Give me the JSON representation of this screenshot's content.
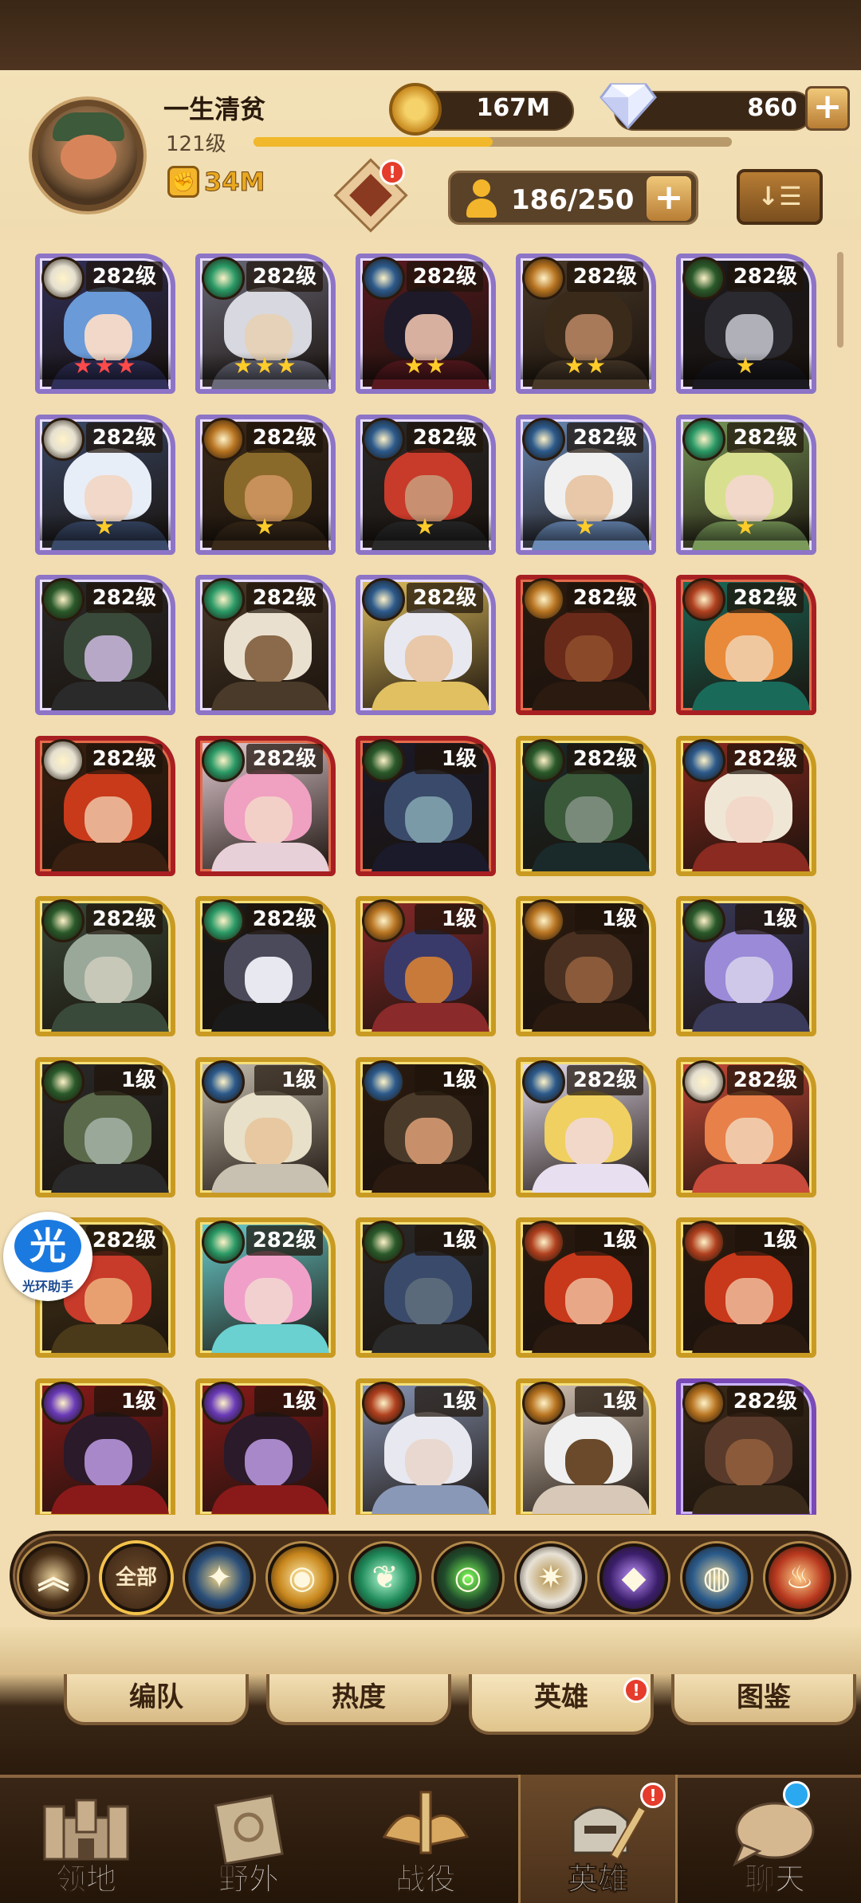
{
  "header": {
    "player_name": "一生清贫",
    "player_level": "121级",
    "xp_progress": 0.5,
    "power": "34M",
    "gold": "167M",
    "gems": "860",
    "plus": "+",
    "craft_badge": "!",
    "hero_count": "186/250",
    "sort_icon": "↓☰"
  },
  "heroes": [
    {
      "level": "282级",
      "faction": "celestial",
      "frame": "purple",
      "stars": "★★★",
      "star_color": "red"
    },
    {
      "level": "282级",
      "faction": "wilder",
      "frame": "purple",
      "stars": "★★★",
      "star_color": "gold"
    },
    {
      "level": "282级",
      "faction": "lightbearer",
      "frame": "purple",
      "stars": "★★",
      "star_color": "gold"
    },
    {
      "level": "282级",
      "faction": "mauler",
      "frame": "purple",
      "stars": "★★",
      "star_color": "gold"
    },
    {
      "level": "282级",
      "faction": "graveborn",
      "frame": "purple",
      "stars": "★",
      "star_color": "gold"
    },
    {
      "level": "282级",
      "faction": "celestial",
      "frame": "purple",
      "stars": "★",
      "star_color": "gold"
    },
    {
      "level": "282级",
      "faction": "mauler",
      "frame": "purple",
      "stars": "★",
      "star_color": "gold"
    },
    {
      "level": "282级",
      "faction": "lightbearer",
      "frame": "purple",
      "stars": "★",
      "star_color": "gold"
    },
    {
      "level": "282级",
      "faction": "lightbearer",
      "frame": "purple",
      "stars": "★",
      "star_color": "gold"
    },
    {
      "level": "282级",
      "faction": "wilder",
      "frame": "purple",
      "stars": "★",
      "star_color": "gold"
    },
    {
      "level": "282级",
      "faction": "graveborn",
      "frame": "purple",
      "stars": "",
      "star_color": "gold"
    },
    {
      "level": "282级",
      "faction": "wilder",
      "frame": "purple",
      "stars": "",
      "star_color": "gold"
    },
    {
      "level": "282级",
      "faction": "lightbearer",
      "frame": "purple",
      "stars": "",
      "star_color": "gold"
    },
    {
      "level": "282级",
      "faction": "mauler",
      "frame": "red",
      "stars": "",
      "star_color": "gold"
    },
    {
      "level": "282级",
      "faction": "hypogean",
      "frame": "red",
      "stars": "",
      "star_color": "gold"
    },
    {
      "level": "282级",
      "faction": "celestial",
      "frame": "red",
      "stars": "",
      "star_color": "gold"
    },
    {
      "level": "282级",
      "faction": "wilder",
      "frame": "red",
      "stars": "",
      "star_color": "gold"
    },
    {
      "level": "1级",
      "faction": "graveborn",
      "frame": "red",
      "stars": "",
      "star_color": "gold"
    },
    {
      "level": "282级",
      "faction": "graveborn",
      "frame": "gold",
      "stars": "",
      "star_color": "gold"
    },
    {
      "level": "282级",
      "faction": "lightbearer",
      "frame": "gold",
      "stars": "",
      "star_color": "gold"
    },
    {
      "level": "282级",
      "faction": "graveborn",
      "frame": "gold",
      "stars": "",
      "star_color": "gold"
    },
    {
      "level": "282级",
      "faction": "wilder",
      "frame": "gold",
      "stars": "",
      "star_color": "gold"
    },
    {
      "level": "1级",
      "faction": "mauler",
      "frame": "gold",
      "stars": "",
      "star_color": "gold"
    },
    {
      "level": "1级",
      "faction": "mauler",
      "frame": "gold",
      "stars": "",
      "star_color": "gold"
    },
    {
      "level": "1级",
      "faction": "graveborn",
      "frame": "gold",
      "stars": "",
      "star_color": "gold"
    },
    {
      "level": "1级",
      "faction": "graveborn",
      "frame": "gold",
      "stars": "",
      "star_color": "gold"
    },
    {
      "level": "1级",
      "faction": "lightbearer",
      "frame": "gold",
      "stars": "",
      "star_color": "gold"
    },
    {
      "level": "1级",
      "faction": "lightbearer",
      "frame": "gold",
      "stars": "",
      "star_color": "gold"
    },
    {
      "level": "282级",
      "faction": "lightbearer",
      "frame": "gold",
      "stars": "",
      "star_color": "gold"
    },
    {
      "level": "282级",
      "faction": "celestial",
      "frame": "gold",
      "stars": "",
      "star_color": "gold"
    },
    {
      "level": "282级",
      "faction": "hypogean",
      "frame": "gold",
      "stars": "",
      "star_color": "gold"
    },
    {
      "level": "282级",
      "faction": "wilder",
      "frame": "gold",
      "stars": "",
      "star_color": "gold"
    },
    {
      "level": "1级",
      "faction": "graveborn",
      "frame": "gold",
      "stars": "",
      "star_color": "gold"
    },
    {
      "level": "1级",
      "faction": "hypogean",
      "frame": "gold",
      "stars": "",
      "star_color": "gold"
    },
    {
      "level": "1级",
      "faction": "hypogean",
      "frame": "gold",
      "stars": "",
      "star_color": "gold"
    },
    {
      "level": "1级",
      "faction": "dimensional",
      "frame": "gold",
      "stars": "",
      "star_color": "gold"
    },
    {
      "level": "1级",
      "faction": "dimensional",
      "frame": "gold",
      "stars": "",
      "star_color": "gold"
    },
    {
      "level": "1级",
      "faction": "hypogean",
      "frame": "gold",
      "stars": "",
      "star_color": "gold"
    },
    {
      "level": "1级",
      "faction": "mauler",
      "frame": "gold",
      "stars": "",
      "star_color": "gold"
    },
    {
      "level": "282级",
      "faction": "mauler",
      "frame": "violet",
      "stars": "",
      "star_color": "gold"
    }
  ],
  "assistant": {
    "glyph": "光",
    "label": "光环助手"
  },
  "filters": [
    {
      "id": "up",
      "glyph": "︽",
      "color": "#4a3018",
      "accent": "#e8cf9a"
    },
    {
      "id": "all",
      "glyph": "全部",
      "color": "#3a2414",
      "accent": "#f7e6c2"
    },
    {
      "id": "lightbearer",
      "glyph": "✦",
      "color": "#2a4e78",
      "accent": "#f0d486"
    },
    {
      "id": "mauler",
      "glyph": "◉",
      "color": "#c8861c",
      "accent": "#fff0b0"
    },
    {
      "id": "wilder",
      "glyph": "❦",
      "color": "#1f8a5a",
      "accent": "#b8ffd6"
    },
    {
      "id": "graveborn",
      "glyph": "◎",
      "color": "#1f4a2a",
      "accent": "#7dff5a"
    },
    {
      "id": "celestial",
      "glyph": "✷",
      "color": "#e8e2d6",
      "accent": "#b08a40"
    },
    {
      "id": "hypogean",
      "glyph": "◆",
      "color": "#3a1e6a",
      "accent": "#c596ff"
    },
    {
      "id": "dimensional",
      "glyph": "◍",
      "color": "#2a5a8a",
      "accent": "#e8d49a"
    },
    {
      "id": "demon",
      "glyph": "♨",
      "color": "#b8381e",
      "accent": "#ffcf8a"
    }
  ],
  "subtabs": [
    {
      "label": "编队"
    },
    {
      "label": "热度"
    },
    {
      "label": "英雄",
      "active": true
    },
    {
      "label": "图鉴"
    }
  ],
  "subtab_badge": "!",
  "nav": [
    {
      "label": "领地"
    },
    {
      "label": "野外"
    },
    {
      "label": "战役"
    },
    {
      "label": "英雄",
      "active": true
    },
    {
      "label": "聊天"
    }
  ],
  "nav_badge": "!",
  "faction_colors": {
    "lightbearer": "#2c5a8c",
    "mauler": "#b87420",
    "wilder": "#2a9a66",
    "graveborn": "#2a5a2a",
    "celestial": "#e6e0d0",
    "hypogean": "#b0401e",
    "dimensional": "#6a3ab8"
  }
}
